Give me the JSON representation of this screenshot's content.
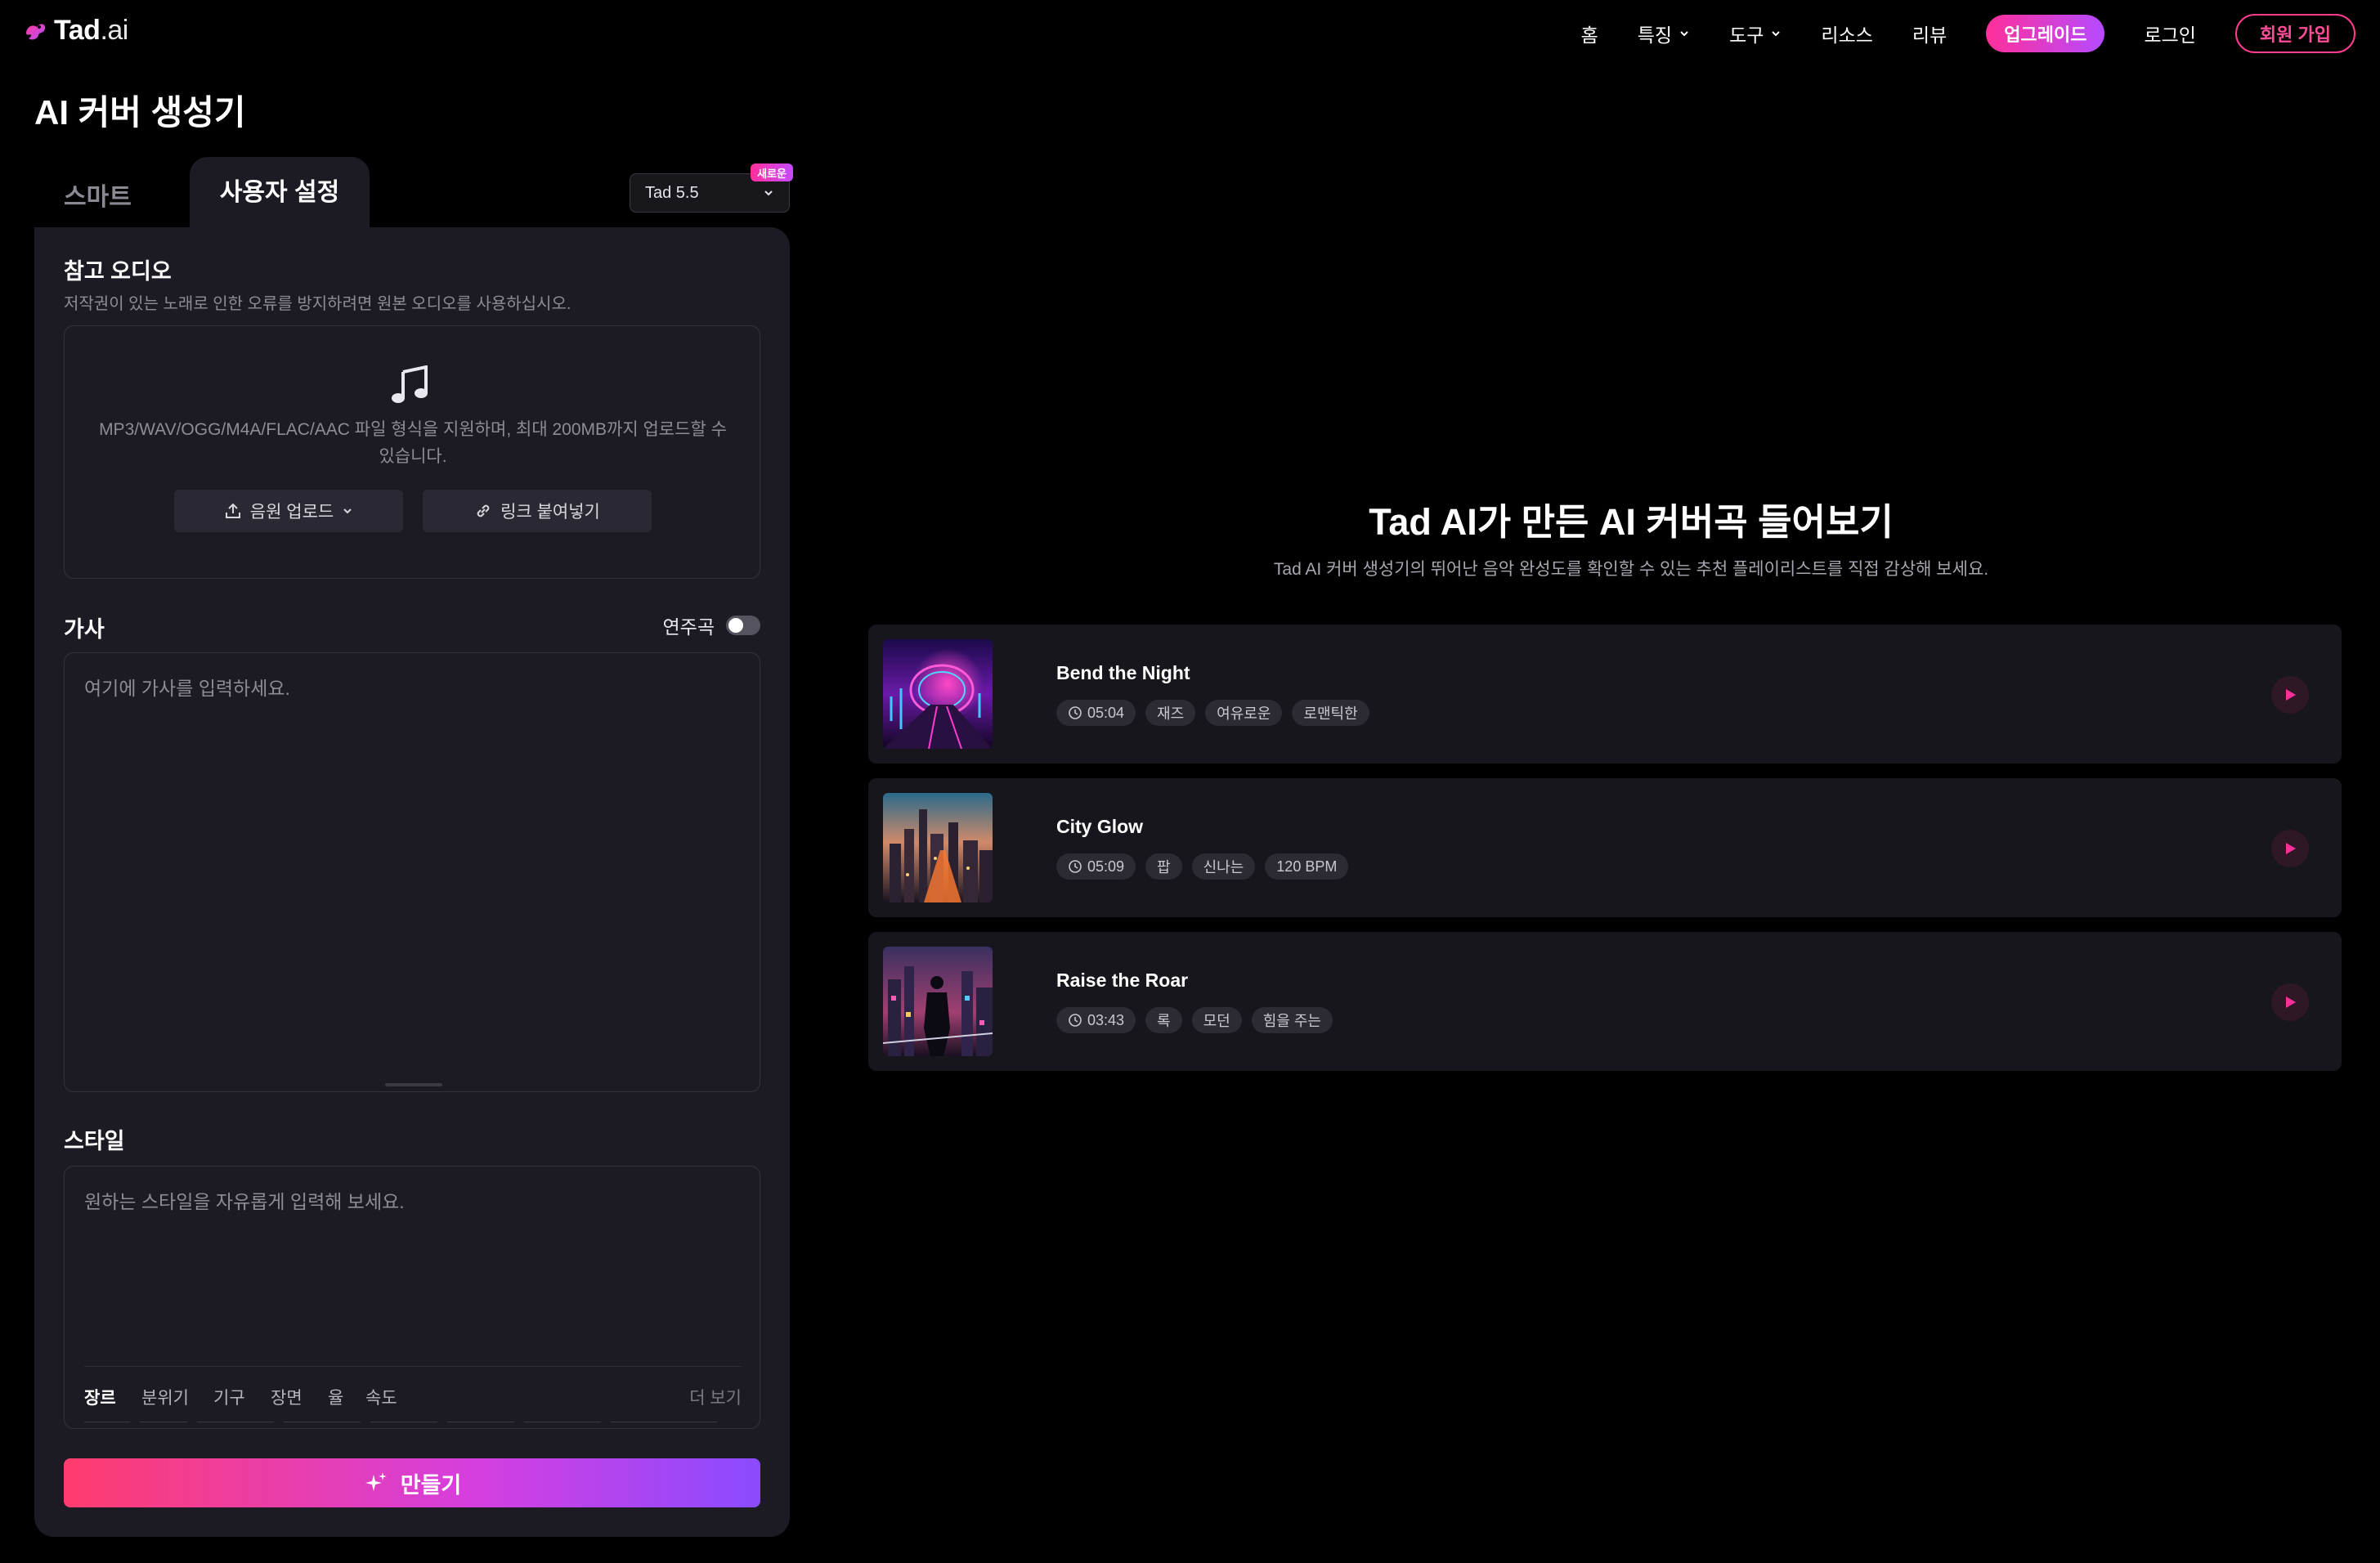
{
  "header": {
    "logo_text": "Tad",
    "logo_suffix": ".ai",
    "nav": {
      "home": "홈",
      "features": "특징",
      "tools": "도구",
      "resources": "리소스",
      "reviews": "리뷰",
      "upgrade": "업그레이드",
      "login": "로그인",
      "signup": "회원 가입"
    }
  },
  "page_title": "AI 커버 생성기",
  "tabs": {
    "smart": "스마트",
    "custom": "사용자 설정"
  },
  "model": {
    "value": "Tad 5.5",
    "badge": "새로운"
  },
  "reference_audio": {
    "title": "참고 오디오",
    "subtitle": "저작권이 있는 노래로 인한 오류를 방지하려면 원본 오디오를 사용하십시오.",
    "hint": "MP3/WAV/OGG/M4A/FLAC/AAC 파일 형식을 지원하며, 최대 200MB까지 업로드할 수 있습니다.",
    "upload_label": "음원 업로드",
    "link_label": "링크 붙여넣기"
  },
  "lyrics": {
    "title": "가사",
    "instrumental_label": "연주곡",
    "instrumental_on": false,
    "placeholder": "여기에 가사를 입력하세요."
  },
  "style": {
    "title": "스타일",
    "placeholder": "원하는 스타일을 자유롭게 입력해 보세요.",
    "tabs": [
      "장르",
      "분위기",
      "기구",
      "장면",
      "율",
      "속도"
    ],
    "active_tab": 0,
    "more": "더 보기"
  },
  "create_button": "만들기",
  "showcase": {
    "title": "Tad AI가 만든 AI 커버곡 들어보기",
    "subtitle": "Tad AI 커버 생성기의 뛰어난 음악 완성도를 확인할 수 있는 추천 플레이리스트를 직접 감상해 보세요.",
    "tracks": [
      {
        "title": "Bend the Night",
        "duration": "05:04",
        "tags": [
          "재즈",
          "여유로운",
          "로맨틱한"
        ]
      },
      {
        "title": "City Glow",
        "duration": "05:09",
        "tags": [
          "팝",
          "신나는",
          "120 BPM"
        ]
      },
      {
        "title": "Raise the Roar",
        "duration": "03:43",
        "tags": [
          "록",
          "모던",
          "힘을 주는"
        ]
      }
    ]
  },
  "colors": {
    "accent_pink": "#ff2f9a",
    "accent_purple": "#8a4bff",
    "panel_bg": "#1c1b24"
  }
}
